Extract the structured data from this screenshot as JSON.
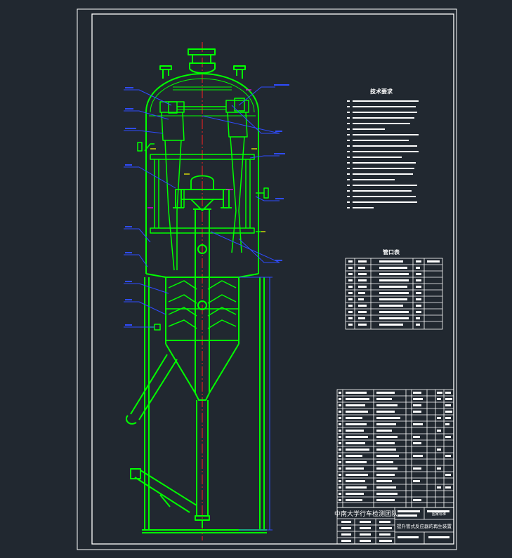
{
  "colors": {
    "background": "#212830",
    "frame": "#ffffff",
    "vessel": "#00ff00",
    "centerline": "#ff2020",
    "leader": "#2f4cff",
    "accent": "#ffff00",
    "magenta": "#ff00ff",
    "cyan": "#00ffff"
  },
  "tech_requirements": {
    "title": "技术要求"
  },
  "nozzle_table": {
    "title": "管口表"
  },
  "title_block": {
    "org": "中南大学行车检测团队",
    "drawing_title": "提升管式反应器的再生装置",
    "stamp": "国家标准"
  }
}
